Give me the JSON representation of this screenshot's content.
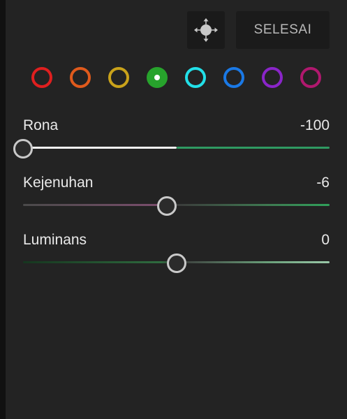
{
  "header": {
    "target_icon": "target-move-icon",
    "done_label": "SELESAI"
  },
  "colors": {
    "swatches": [
      {
        "name": "red",
        "color": "#e01f1f",
        "selected": false
      },
      {
        "name": "orange",
        "color": "#e05a1c",
        "selected": false
      },
      {
        "name": "yellow",
        "color": "#c9a21a",
        "selected": false
      },
      {
        "name": "green",
        "color": "#27a32c",
        "selected": true
      },
      {
        "name": "aqua",
        "color": "#22e0e8",
        "selected": false
      },
      {
        "name": "blue",
        "color": "#1a79e6",
        "selected": false
      },
      {
        "name": "purple",
        "color": "#8a25c9",
        "selected": false
      },
      {
        "name": "magenta",
        "color": "#b0186e",
        "selected": false
      }
    ]
  },
  "sliders": {
    "hue": {
      "label": "Rona",
      "value": "-100",
      "fraction": 0.0
    },
    "saturation": {
      "label": "Kejenuhan",
      "value": "-6",
      "fraction": 0.47
    },
    "luminance": {
      "label": "Luminans",
      "value": "0",
      "fraction": 0.5
    }
  }
}
